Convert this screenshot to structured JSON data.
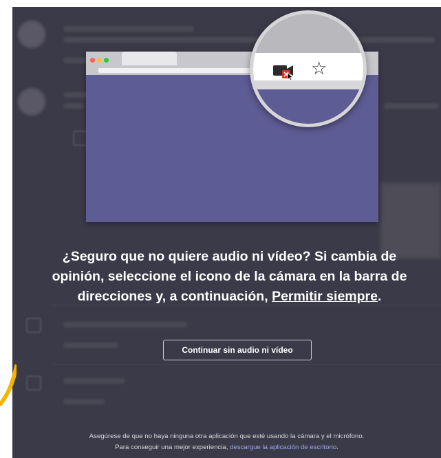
{
  "dialog": {
    "prompt_line_1": "¿Seguro que no quiere audio ni vídeo? Si cambia de",
    "prompt_line_2": "opinión, seleccione el icono de la cámara en la barra de",
    "prompt_line_3_start": "direcciones y, a continuación, ",
    "prompt_link": "Permitir siempre",
    "prompt_line_3_end": ".",
    "continue_button": "Continuar sin audio ni vídeo",
    "footer_line_1": "Asegúrese de que no haya ninguna otra aplicación que esté usando la cámara y el micrófono.",
    "footer_line_2_start": "Para conseguir una mejor experiencia, ",
    "footer_link": "descargue la aplicación de escritorio",
    "footer_line_2_end": "."
  },
  "icons": [
    "camera-blocked-icon",
    "star-icon",
    "mouse-pointer-icon"
  ],
  "colors": {
    "overlay_background": "#3b3a48",
    "illustration_purple": "#5e5c94",
    "link": "#9ea8e8",
    "accent_arrow": "#f5b400"
  }
}
